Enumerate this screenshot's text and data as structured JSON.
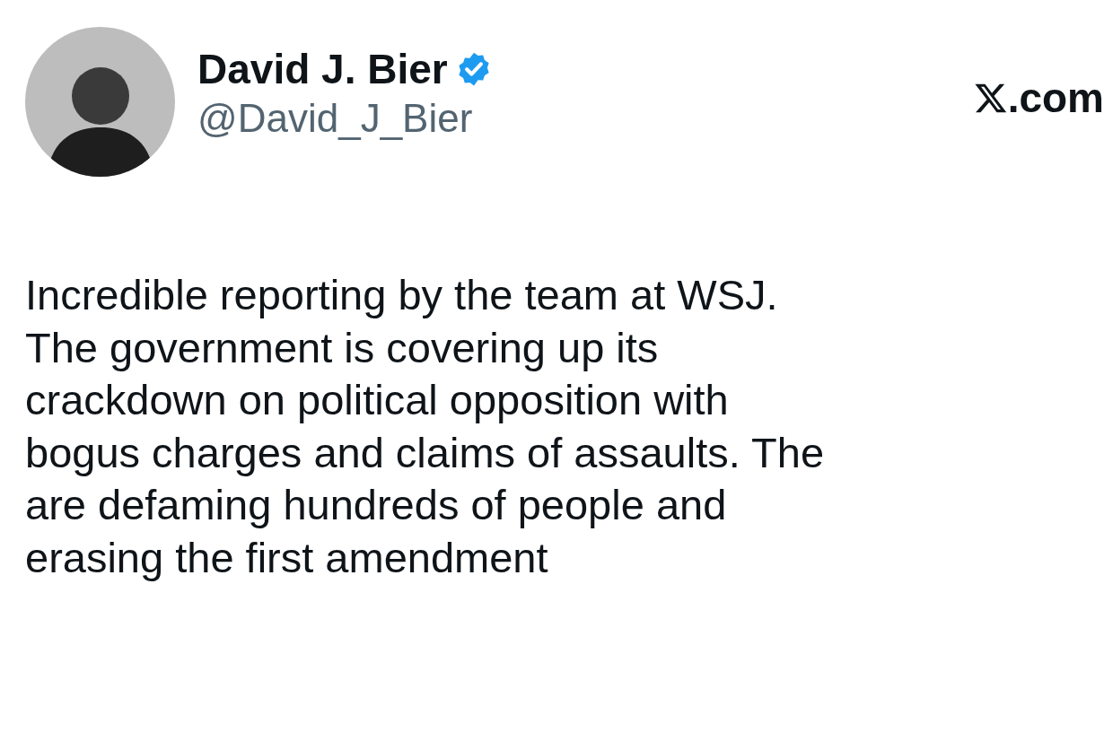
{
  "author": {
    "name": "David J. Bier",
    "verified": true,
    "handle": "@David_J_Bier"
  },
  "source": {
    "domain": ".com"
  },
  "tweet": {
    "lines": [
      "Incredible reporting by the team at WSJ.",
      "The government is covering up its",
      "crackdown on political opposition with",
      "bogus charges and claims of assaults. The",
      "are defaming hundreds of people and",
      "erasing the first amendment"
    ]
  }
}
